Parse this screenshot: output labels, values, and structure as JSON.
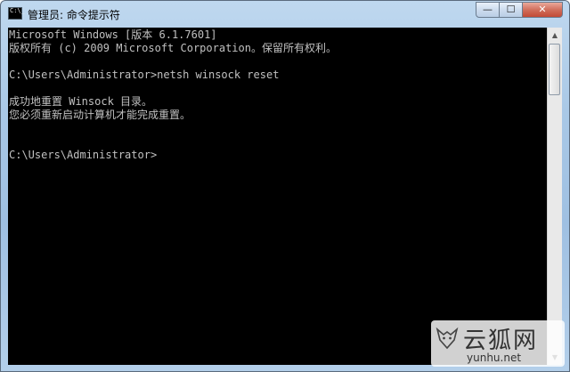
{
  "window": {
    "title": "管理员: 命令提示符",
    "icon_text": "C:\\_",
    "controls": {
      "minimize_glyph": "—",
      "maximize_glyph": "☐",
      "close_glyph": "✕"
    }
  },
  "console": {
    "lines": [
      "Microsoft Windows [版本 6.1.7601]",
      "版权所有 (c) 2009 Microsoft Corporation。保留所有权利。",
      "",
      "C:\\Users\\Administrator>netsh winsock reset",
      "",
      "成功地重置 Winsock 目录。",
      "您必须重新启动计算机才能完成重置。",
      "",
      "",
      "C:\\Users\\Administrator>"
    ],
    "text_color": "#c0c0c0",
    "background_color": "#000000"
  },
  "scrollbar": {
    "up_glyph": "▲",
    "down_glyph": "▼"
  },
  "watermark": {
    "name_cn": "云狐网",
    "url": "yunhu.net"
  }
}
